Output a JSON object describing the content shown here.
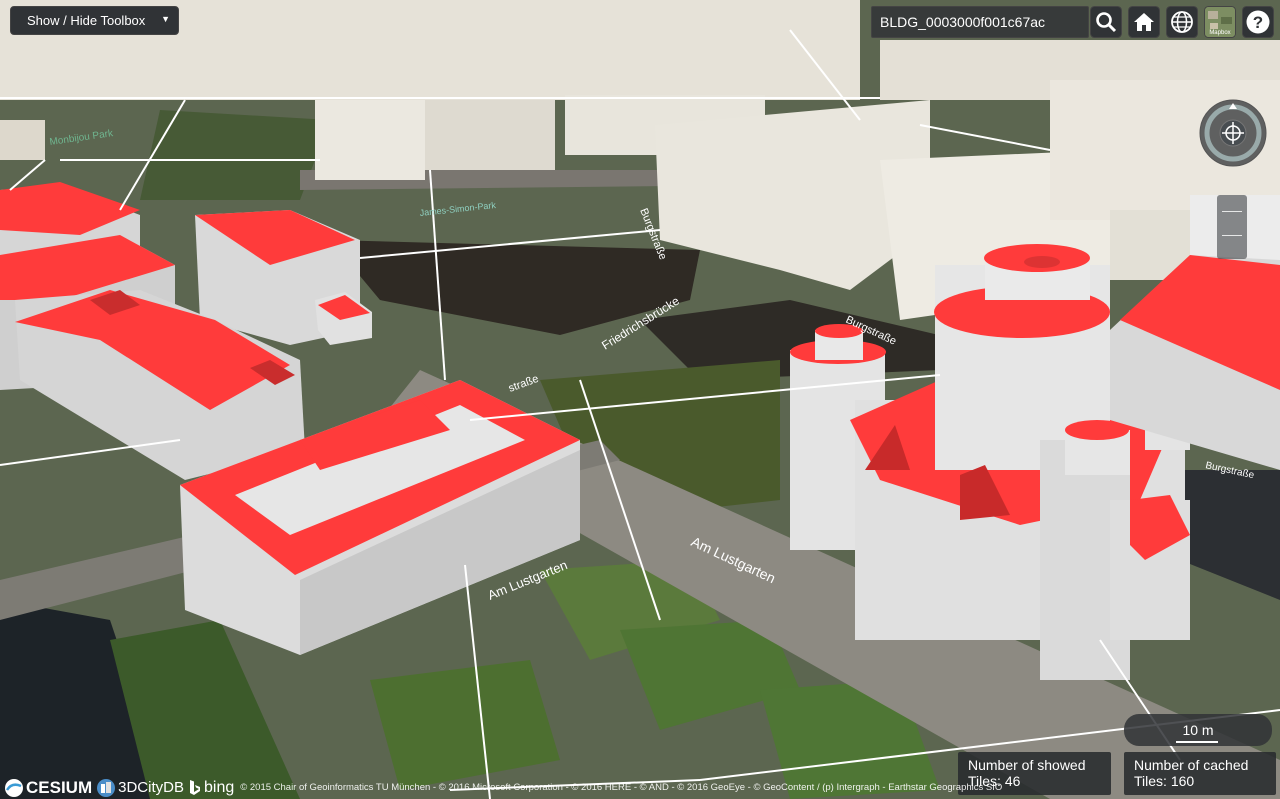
{
  "toolbox": {
    "label": "Show / Hide Toolbox"
  },
  "search": {
    "value": "BLDG_0003000f001c67ac"
  },
  "toolbar": {
    "search_icon": "search-icon",
    "home_icon": "home-icon",
    "globe_icon": "globe-icon",
    "basemap_icon": "basemap-icon",
    "help_icon": "help-icon",
    "basemap_label": "Mapbox",
    "help_label": "?"
  },
  "map": {
    "street_labels": [
      {
        "id": "am-lustgarten-1",
        "text": "Am Lustgarten"
      },
      {
        "id": "am-lustgarten-2",
        "text": "Am Lustgarten"
      },
      {
        "id": "burgstrasse-1",
        "text": "Burgstraße"
      },
      {
        "id": "burgstrasse-2",
        "text": "Burgstraße"
      },
      {
        "id": "burgstrasse-3",
        "text": "Burgstraße"
      },
      {
        "id": "friedrichsbruecke",
        "text": "Friedrichsbrücke"
      },
      {
        "id": "strasse",
        "text": "straße"
      },
      {
        "id": "james-simon-park",
        "text": "James-Simon-Park"
      },
      {
        "id": "monbijoupark",
        "text": "Monbijou Park"
      }
    ],
    "colors": {
      "highlight_roof": "#ff3b3b",
      "building_wall": "#e8e6e0",
      "highlight_wall": "#cfcfcf",
      "water": "#2f2a24",
      "grass": "#5a7a3a"
    }
  },
  "distance_legend": {
    "label": "10 m"
  },
  "stats": {
    "showed_title": "Number of showed",
    "showed_value": "Tiles: 46",
    "cached_title": "Number of cached",
    "cached_value": "Tiles: 160"
  },
  "credits": {
    "cesium": "CESIUM",
    "citydb": "3DCityDB",
    "bing": "bing",
    "text": "© 2015 Chair of Geoinformatics TU München - © 2016 Microsoft Corporation - © 2016 HERE - © AND - © 2016 GeoEye - © GeoContent / (p) Intergraph - Earthstar Geographics SIO"
  }
}
